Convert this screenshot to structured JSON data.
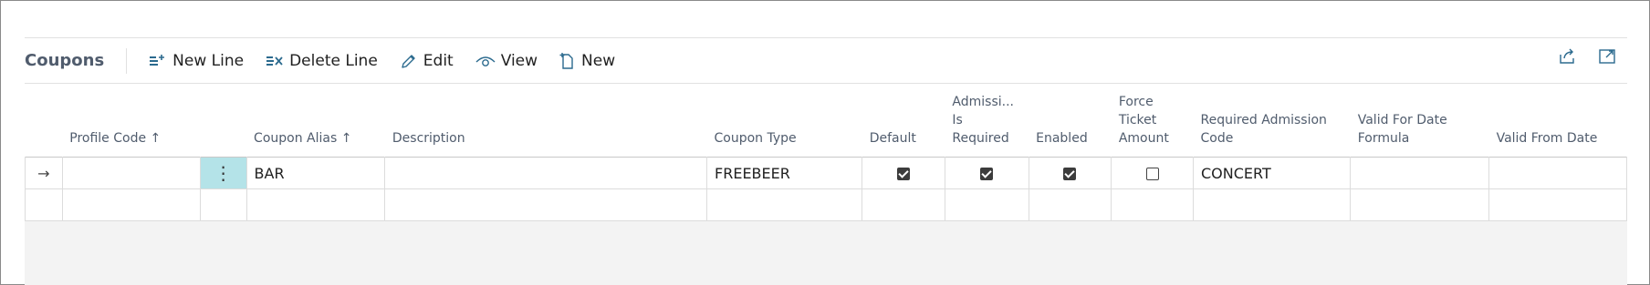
{
  "part": {
    "title": "Coupons"
  },
  "toolbar": {
    "actions": [
      {
        "label": "New Line",
        "icon": "new-line-icon"
      },
      {
        "label": "Delete Line",
        "icon": "delete-line-icon"
      },
      {
        "label": "Edit",
        "icon": "pencil-icon"
      },
      {
        "label": "View",
        "icon": "eye-icon"
      },
      {
        "label": "New",
        "icon": "new-document-icon"
      }
    ],
    "right_icons": [
      "share-icon",
      "open-in-new-window-icon"
    ]
  },
  "columns": [
    {
      "label": "Profile Code",
      "sort": "↑"
    },
    {
      "label": "Coupon Alias",
      "sort": "↑"
    },
    {
      "label": "Description"
    },
    {
      "label": "Coupon Type"
    },
    {
      "label": "Default"
    },
    {
      "label_lines": [
        "Admissi...",
        "Is",
        "Required"
      ]
    },
    {
      "label": "Enabled"
    },
    {
      "label_lines": [
        "Force",
        "Ticket",
        "Amount"
      ]
    },
    {
      "label_lines": [
        "Required Admission",
        "Code"
      ]
    },
    {
      "label_lines": [
        "Valid For Date",
        "Formula"
      ]
    },
    {
      "label": "Valid From Date"
    }
  ],
  "rows": [
    {
      "current": true,
      "row_marker": "→",
      "menu": "⋮",
      "profile_code": "",
      "coupon_alias": "BAR",
      "description": "",
      "coupon_type": "FREEBEER",
      "default": true,
      "admission_required": true,
      "enabled": true,
      "force_ticket_amount": false,
      "required_admission_code": "CONCERT",
      "valid_for_date_formula": "",
      "valid_from_date": ""
    },
    {
      "current": false,
      "row_marker": "",
      "menu": "",
      "profile_code": "",
      "coupon_alias": "",
      "description": "",
      "coupon_type": "",
      "default": null,
      "admission_required": null,
      "enabled": null,
      "force_ticket_amount": null,
      "required_admission_code": "",
      "valid_for_date_formula": "",
      "valid_from_date": ""
    }
  ]
}
